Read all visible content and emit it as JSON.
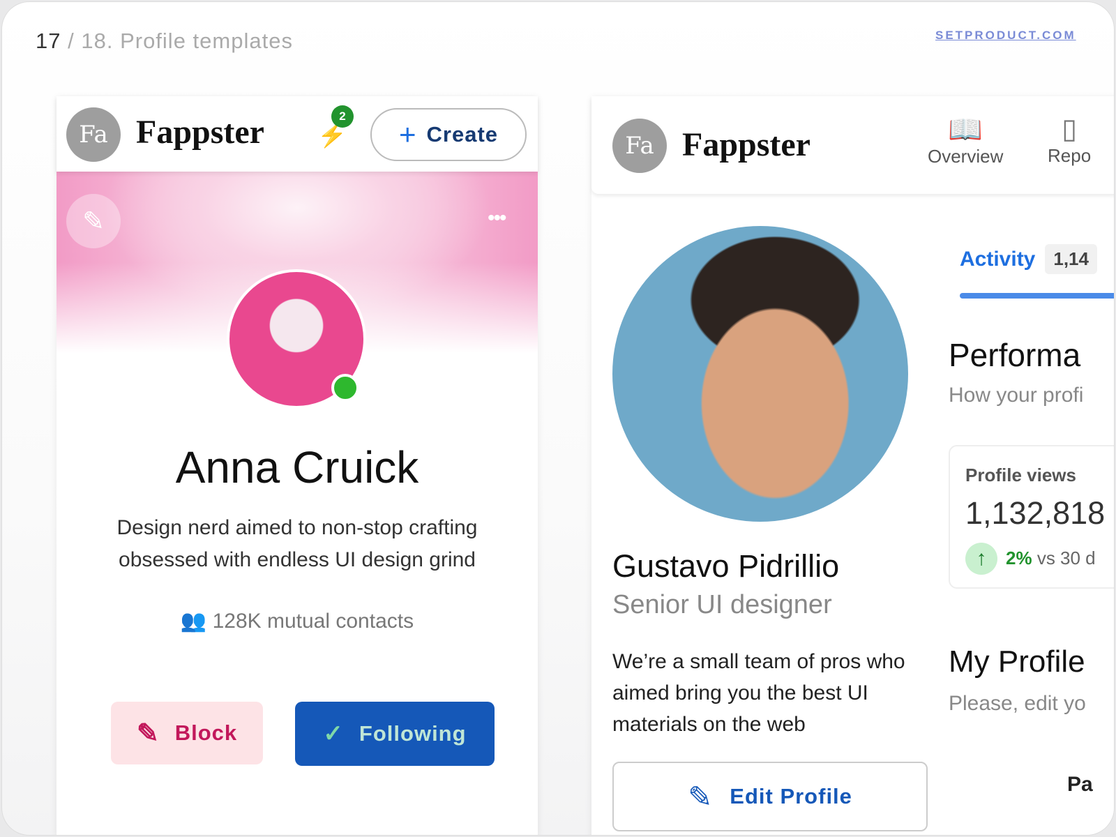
{
  "breadcrumb": {
    "current": "17",
    "separator": "/",
    "title": "18. Profile templates"
  },
  "site": "SETPRODUCT.COM",
  "left_card": {
    "logo": "Fa",
    "brand": "Fappster",
    "notification_count": "2",
    "create_label": "Create",
    "name": "Anna Cruick",
    "bio_line1": "Design nerd aimed to non-stop crafting",
    "bio_line2": "obsessed with endless UI design grind",
    "mutual": "128K mutual contacts",
    "block_label": "Block",
    "following_label": "Following",
    "colors": {
      "accent": "#1558b8",
      "block_bg": "#fde3e6",
      "block_text": "#c2185b",
      "online": "#2eb82e"
    }
  },
  "right_card": {
    "logo": "Fa",
    "brand": "Fappster",
    "nav": [
      {
        "label": "Overview",
        "icon": "book-icon"
      },
      {
        "label": "Repo",
        "icon": "report-icon"
      }
    ],
    "name": "Gustavo Pidrillio",
    "role": "Senior UI designer",
    "bio_line1": "We’re a small team of pros who",
    "bio_line2": "aimed bring you the best UI",
    "bio_line3": "materials on the web",
    "edit_label": "Edit Profile",
    "activity_tab": "Activity",
    "activity_count": "1,14",
    "perf_title": "Performa",
    "perf_sub": "How your profi",
    "stat_label": "Profile views",
    "stat_value": "1,132,818",
    "stat_change": "2%",
    "stat_compare": "vs 30 d",
    "myprofile_title": "My Profile",
    "myprofile_sub": "Please, edit yo",
    "partial": "Pa"
  }
}
